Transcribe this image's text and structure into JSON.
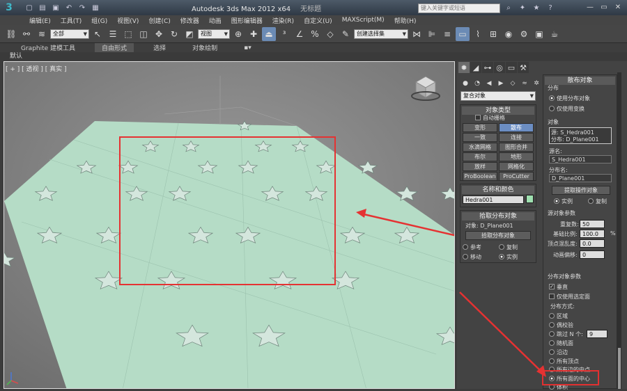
{
  "titlebar": {
    "logo": "3",
    "app_title": "Autodesk 3ds Max  2012 x64",
    "doc_title": "无标题",
    "search_placeholder": "键入关键字或短语",
    "controls": [
      "—",
      "▭",
      "✕"
    ]
  },
  "menu": [
    "编辑(E)",
    "工具(T)",
    "组(G)",
    "视图(V)",
    "创建(C)",
    "修改器",
    "动画",
    "图形编辑器",
    "渲染(R)",
    "自定义(U)",
    "MAXScript(M)",
    "帮助(H)"
  ],
  "toolbar": {
    "selection_filter": "全部",
    "ref_coord": "视图",
    "named_selection": "创建选择集"
  },
  "ribbon": {
    "tabs": [
      "Graphite 建模工具",
      "自由形式",
      "选择",
      "对象绘制"
    ],
    "sub": "默认"
  },
  "viewport": {
    "label": "[ + ] [ 透视 ] [ 真实 ]"
  },
  "panel": {
    "category_dropdown": "复合对象",
    "object_type": {
      "header": "对象类型",
      "autogrid": "自动栅格",
      "buttons": [
        "变形",
        "散布",
        "一致",
        "连接",
        "水滴网格",
        "图形合并",
        "布尔",
        "地形",
        "放样",
        "网格化",
        "ProBoolean",
        "ProCutter"
      ]
    },
    "name_color": {
      "header": "名称和颜色",
      "name": "Hedra001"
    },
    "pick_dist": {
      "header": "拾取分布对象",
      "object_label": "对象: D_Plane001",
      "pick_button": "拾取分布对象",
      "options": [
        "参考",
        "复制",
        "移动",
        "实例"
      ]
    },
    "scatter": {
      "header": "散布对象",
      "dist_group": "分布",
      "dist_options": [
        "使用分布对象",
        "仅使用变换"
      ],
      "objects_group": "对象",
      "objects_list": [
        "源: S_Hedra001",
        "分布: D_Plane001"
      ],
      "source_name_label": "源名:",
      "source_name": "S_Hedra001",
      "dist_name_label": "分布名:",
      "dist_name": "D_Plane001",
      "extract_button": "提取操作对象",
      "extract_options": [
        "实例",
        "复制"
      ],
      "source_params_header": "源对象参数",
      "duplicates_label": "重复数:",
      "duplicates": "50",
      "base_scale_label": "基础比例:",
      "base_scale": "100.0",
      "pct": "%",
      "vertex_chaos_label": "顶点混乱度:",
      "vertex_chaos": "0.0",
      "anim_offset_label": "动画偏移:",
      "anim_offset": "0",
      "dist_params_header": "分布对象参数",
      "perpendicular": "垂直",
      "selected_faces": "仅使用选定面",
      "dist_method": "分布方式:",
      "methods": [
        "区域",
        "偶校验",
        "跳过 N 个:",
        "随机面",
        "沿边",
        "所有顶点",
        "所有边的中点",
        "所有面的中心",
        "体积"
      ],
      "skip_n": "9"
    }
  }
}
